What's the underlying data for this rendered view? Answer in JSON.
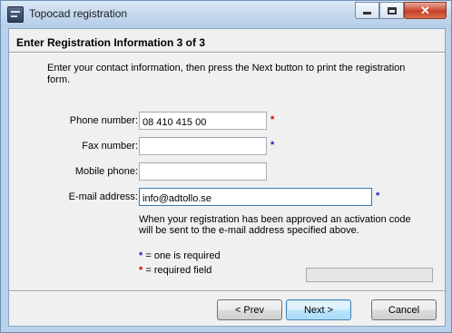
{
  "window": {
    "title": "Topocad registration"
  },
  "wizard": {
    "heading": "Enter Registration Information 3 of 3",
    "intro": "Enter your contact information, then press the Next button to print the registration form."
  },
  "fields": {
    "phone": {
      "label": "Phone number:",
      "value": "08 410 415 00",
      "mark": "*"
    },
    "fax": {
      "label": "Fax number:",
      "value": "",
      "mark": "*"
    },
    "mobile": {
      "label": "Mobile phone:",
      "value": ""
    },
    "email": {
      "label": "E-mail address:",
      "value": "info@adtollo.se",
      "mark": "*"
    }
  },
  "note": "When your registration has been approved an activation code will be sent to the e-mail address specified above.",
  "legend": {
    "one_required": {
      "mark": "*",
      "text": "= one is required"
    },
    "required": {
      "mark": "*",
      "text": "= required field"
    }
  },
  "progress": {
    "value": 0
  },
  "buttons": {
    "prev": "< Prev",
    "next": "Next >",
    "cancel": "Cancel"
  },
  "colors": {
    "required_mark": "#d40000",
    "one_required_mark": "#1c1cc4"
  }
}
